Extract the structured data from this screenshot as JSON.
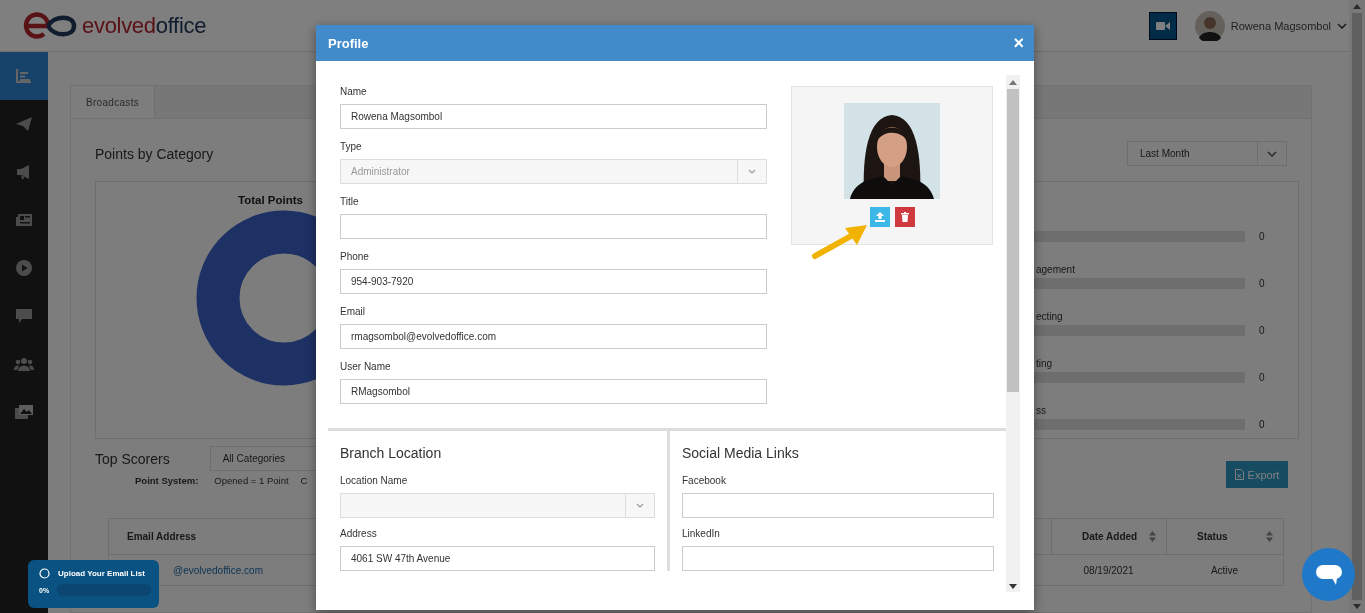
{
  "header": {
    "logo_part1": "evolved",
    "logo_part2": "office",
    "user_name": "Rowena Magsombol"
  },
  "sidebar": {
    "items": [
      {
        "kind": "chart",
        "selected": true
      },
      {
        "kind": "send",
        "selected": false
      },
      {
        "kind": "megaphone",
        "selected": false
      },
      {
        "kind": "news",
        "selected": false
      },
      {
        "kind": "play",
        "selected": false
      },
      {
        "kind": "chat",
        "selected": false
      },
      {
        "kind": "users",
        "selected": false
      },
      {
        "kind": "images",
        "selected": false
      }
    ]
  },
  "tabs": [
    {
      "label": "Broadcasts",
      "selected": true
    }
  ],
  "points_by_category": {
    "title": "Points by Category",
    "period": "Last Month",
    "chart_title": "Total Points",
    "bars": [
      {
        "value": "0",
        "level": 0
      },
      {
        "label": "agement",
        "value": "0",
        "level": 0
      },
      {
        "label": "ecting",
        "value": "0",
        "level": 0
      },
      {
        "label": "ting",
        "value": "0",
        "level": 0
      },
      {
        "label": "ss",
        "value": "0",
        "level": 0
      }
    ]
  },
  "top_scorers": {
    "title": "Top Scorers",
    "category": "All Categories",
    "point_system_label": "Point System:",
    "point_system_items": [
      "Opened = 1 Point",
      "C"
    ],
    "export": "Export",
    "table": {
      "columns": [
        "Email Address",
        "Date Added",
        "Status"
      ],
      "rows": [
        [
          "@evolvedoffice.com",
          "08/19/2021",
          "Active"
        ]
      ]
    }
  },
  "modal": {
    "title": "Profile",
    "close": "×",
    "fields": [
      {
        "label": "Name",
        "value": "Rowena Magsombol",
        "kind": "text",
        "disabled": false
      },
      {
        "label": "Type",
        "value": "Administrator",
        "kind": "select",
        "disabled": true
      },
      {
        "label": "Title",
        "kind": "text",
        "disabled": false
      },
      {
        "label": "Phone",
        "value": "954-903-7920",
        "kind": "text",
        "disabled": false
      },
      {
        "label": "Email",
        "value": "rmagsombol@evolvedoffice.com",
        "kind": "text",
        "disabled": false
      },
      {
        "label": "User Name",
        "value": "RMagsombol",
        "kind": "text",
        "disabled": false
      }
    ],
    "sections": [
      {
        "title": "Branch Location",
        "fields": [
          {
            "label": "Location Name",
            "kind": "select",
            "disabled": true
          },
          {
            "label": "Address",
            "value": "4061 SW 47th Avenue",
            "kind": "text",
            "disabled": false
          }
        ]
      },
      {
        "title": "Social Media Links",
        "fields": [
          {
            "label": "Facebook",
            "kind": "text",
            "disabled": false
          },
          {
            "label": "LinkedIn",
            "kind": "text",
            "disabled": false
          }
        ]
      }
    ]
  },
  "toast": {
    "title": "Upload Your Email List",
    "percent": "0%",
    "level": 0
  }
}
